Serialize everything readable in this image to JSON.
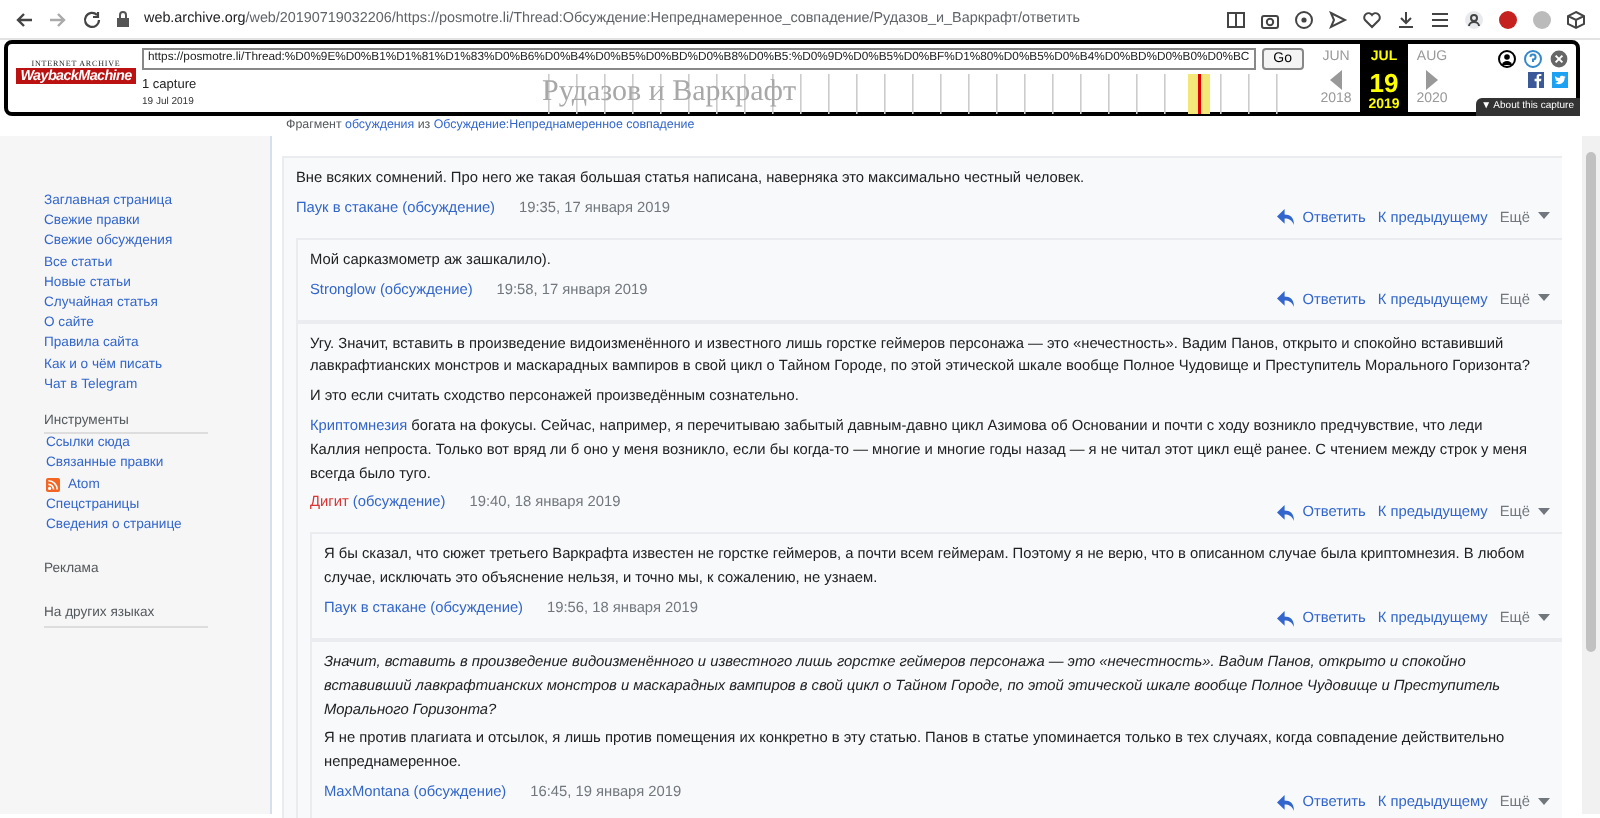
{
  "browser": {
    "url_host": "web.archive.org",
    "url_path": "/web/20190719032206/https://posmotre.li/Thread:Обсуждение:Непреднамеренное_совпадение/Рудазов_и_Варкрафт/ответить"
  },
  "wayback": {
    "logo_top": "INTERNET ARCHIVE",
    "logo_main": "WaybackMachine",
    "url": "https://posmotre.li/Thread:%D0%9E%D0%B1%D1%81%D1%83%D0%B6%D0%B4%D0%B5%D0%BD%D0%B8%D0%B5:%D0%9D%D0%B5%D0%BF%D1%80%D0%B5%D0%B4%D0%BD%D0%B0%D0%BC",
    "go": "Go",
    "captures": "1 capture",
    "capture_date": "19 Jul 2019",
    "months": [
      {
        "label": "JUN",
        "selected": false
      },
      {
        "label": "JUL",
        "selected": true
      },
      {
        "label": "AUG",
        "selected": false
      }
    ],
    "day": "19",
    "years": [
      {
        "label": "2018",
        "selected": false
      },
      {
        "label": "2019",
        "selected": true
      },
      {
        "label": "2020",
        "selected": false
      }
    ],
    "about": "▼ About this capture"
  },
  "page_title": "Рудазов и Варкрафт",
  "fragment": {
    "prefix": "Фрагмент ",
    "link1": "обсуждения",
    "middle": " из ",
    "link2": "Обсуждение:Непреднамеренное совпадение"
  },
  "sidebar": {
    "nav": [
      "Заглавная страница",
      "Свежие правки",
      "Свежие обсуждения",
      "Все статьи",
      "Новые статьи",
      "Случайная статья",
      "О сайте",
      "Правила сайта",
      "Как и о чём писать",
      "Чат в Telegram"
    ],
    "tools_heading": "Инструменты",
    "tools": [
      {
        "label": "Ссылки сюда",
        "kind": "link"
      },
      {
        "label": "Связанные правки",
        "kind": "link"
      },
      {
        "label": "Atom",
        "kind": "feed"
      },
      {
        "label": "Спецстраницы",
        "kind": "link"
      },
      {
        "label": "Сведения о странице",
        "kind": "link"
      }
    ],
    "ads_heading": "Реклама",
    "lang_heading": "На других языках"
  },
  "comments": [
    {
      "paragraphs": [
        {
          "text": "Вне всяких сомнений. Про него же такая большая статья написана, наверняка это максимально честный человек.",
          "italic": false
        }
      ],
      "author": "Паук в стакане",
      "redlink": false,
      "talk": "(обсуждение)",
      "time": "19:35, 17 января 2019",
      "reply": "Ответить",
      "prev": "К предыдущему",
      "more": "Ещё",
      "children": [
        {
          "paragraphs": [
            {
              "text": "Мой сарказмометр аж зашкалило).",
              "italic": false
            }
          ],
          "author": "Stronglow",
          "redlink": false,
          "talk": "(обсуждение)",
          "time": "19:58, 17 января 2019",
          "reply": "Ответить",
          "prev": "К предыдущему",
          "more": "Ещё"
        },
        {
          "paragraphs": [
            {
              "text": "Угу. Значит, вставить в произведение видоизменённого и известного лишь горстке геймеров персонажа — это «нечестность». Вадим Панов, открыто и спокойно вставивший лавкрафтианских монстров и маскарадных вампиров в свой цикл о Тайном Городе, по этой этической шкале вообще Полное Чудовище и Преступитель Морального Горизонта?",
              "italic": false
            },
            {
              "text": "И это если считать сходство персонажей произведённым сознательно.",
              "italic": false
            },
            {
              "link": "Криптомнезия",
              "text": " богата на фокусы. Сейчас, например, я перечитываю забытый давным-давно цикл Азимова об Основании и почти с ходу возникло предчувствие, что леди Каллия непроста. Только вот вряд ли б оно у меня возникло, если бы когда-то — многие и многие годы назад — я не читал этот цикл ещё ранее. С чтением между строк у меня всегда было туго.",
              "italic": false
            }
          ],
          "author": "Дигит",
          "redlink": true,
          "talk": "(обсуждение)",
          "time": "19:40, 18 января 2019",
          "reply": "Ответить",
          "prev": "К предыдущему",
          "more": "Ещё",
          "children": [
            {
              "paragraphs": [
                {
                  "text": "Я бы сказал, что сюжет третьего Варкрафта известен не горстке геймеров, а почти всем геймерам. Поэтому я не верю, что в описанном случае была криптомнезия. В любом случае, исключать это объяснение нельзя, и точно мы, к сожалению, не узнаем.",
                  "italic": false
                }
              ],
              "author": "Паук в стакане",
              "redlink": false,
              "talk": "(обсуждение)",
              "time": "19:56, 18 января 2019",
              "reply": "Ответить",
              "prev": "К предыдущему",
              "more": "Ещё"
            },
            {
              "paragraphs": [
                {
                  "text": "Значит, вставить в произведение видоизменённого и известного лишь горстке геймеров персонажа — это «нечестность». Вадим Панов, открыто и спокойно вставивший лавкрафтианских монстров и маскарадных вампиров в свой цикл о Тайном Городе, по этой этической шкале вообще Полное Чудовище и Преступитель Морального Горизонта?",
                  "italic": true
                },
                {
                  "text": "Я не против плагиата и отсылок, я лишь против помещения их конкретно в эту статью. Панов в статье упоминается только в тех случаях, когда совпадение действительно непреднамеренное.",
                  "italic": false
                }
              ],
              "author": "MaxMontana",
              "redlink": false,
              "talk": "(обсуждение)",
              "time": "16:45, 19 января 2019",
              "reply": "Ответить",
              "prev": "К предыдущему",
              "more": "Ещё"
            }
          ]
        }
      ]
    }
  ]
}
